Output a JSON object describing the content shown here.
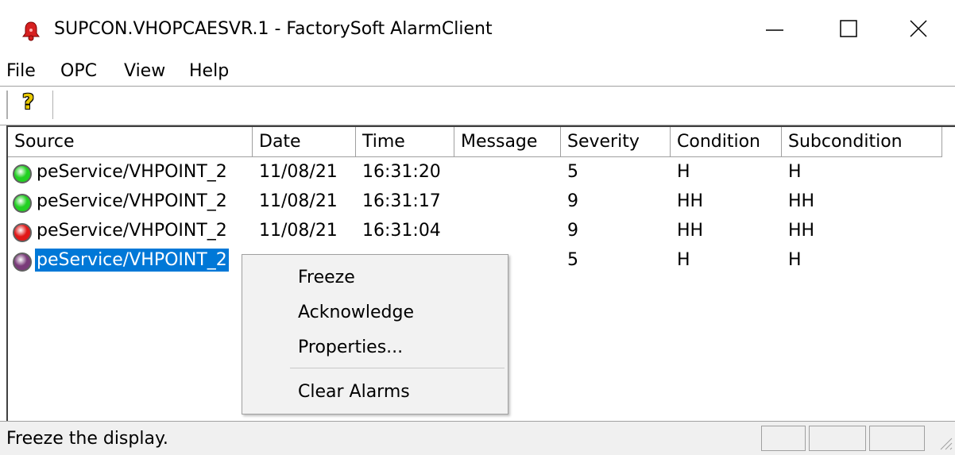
{
  "window": {
    "title": "SUPCON.VHOPCAESVR.1 - FactorySoft AlarmClient",
    "controls": {
      "minimize": "—",
      "maximize": "☐",
      "close": "✕"
    }
  },
  "menu": [
    "File",
    "OPC",
    "View",
    "Help"
  ],
  "toolbar": {
    "help_glyph": "?"
  },
  "columns": [
    "Source",
    "Date",
    "Time",
    "Message",
    "Severity",
    "Condition",
    "Subcondition"
  ],
  "rows": [
    {
      "status_color": "#22d022",
      "source": "peService/VHPOINT_2",
      "date": "11/08/21",
      "time": "16:31:20",
      "message": "",
      "severity": "5",
      "condition": "H",
      "subcondition": "H"
    },
    {
      "status_color": "#22d022",
      "source": "peService/VHPOINT_2",
      "date": "11/08/21",
      "time": "16:31:17",
      "message": "",
      "severity": "9",
      "condition": "HH",
      "subcondition": "HH"
    },
    {
      "status_color": "#e01818",
      "source": "peService/VHPOINT_2",
      "date": "11/08/21",
      "time": "16:31:04",
      "message": "",
      "severity": "9",
      "condition": "HH",
      "subcondition": "HH"
    },
    {
      "status_color": "#7a3a7a",
      "source": "peService/VHPOINT_2",
      "date": "",
      "time": "",
      "message": "",
      "severity": "5",
      "condition": "H",
      "subcondition": "H"
    }
  ],
  "context_menu": [
    "Freeze",
    "Acknowledge",
    "Properties...",
    "Clear Alarms"
  ],
  "status": {
    "text": "Freeze the display."
  },
  "colors": {
    "selection": "#0078d7",
    "app_icon": "#d62020"
  }
}
